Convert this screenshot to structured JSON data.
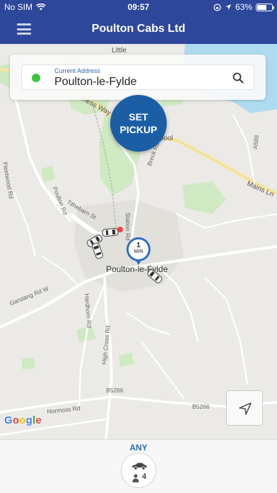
{
  "status_bar": {
    "carrier": "No SIM",
    "time": "09:57",
    "battery": "63%",
    "battery_level": 0.63
  },
  "header": {
    "title": "Poulton Cabs Ltd",
    "menu_icon": "hamburger-menu-icon"
  },
  "address": {
    "label": "Current Address",
    "value": "Poulton-le-Fylde",
    "status_color": "#3cc43c",
    "search_icon": "search-icon"
  },
  "set_pickup": {
    "line1": "SET",
    "line2": "PICKUP"
  },
  "eta_pin": {
    "value": "1",
    "unit": "MIN"
  },
  "map_labels": {
    "little": "Little",
    "harness": "rness Way",
    "pool": "pool",
    "fleetwood_rd": "Fleetwood Rd",
    "poulton_rd": "Poulton Rd",
    "breck_rd": "Breck Rd",
    "tithebarn_st": "Tithebarn St",
    "station_rd": "Station Rd",
    "poulton_town": "Poulton-le-Fylde",
    "garstang_rd": "Garstang Rd W",
    "hardhorn_rd": "Hardhorn Rd",
    "high_cross_rd": "High Cross Rd",
    "b5266_a": "B5266",
    "b5266_b": "B5266",
    "normoss_rd": "Normoss Rd",
    "a588": "A588",
    "mains_ln": "Mains Ln",
    "google": "Google"
  },
  "vehicle_selector": {
    "category": "ANY",
    "capacity": "4",
    "icon": "car-icon"
  },
  "colors": {
    "brand": "#2d479a",
    "accent": "#1c5ea6"
  }
}
